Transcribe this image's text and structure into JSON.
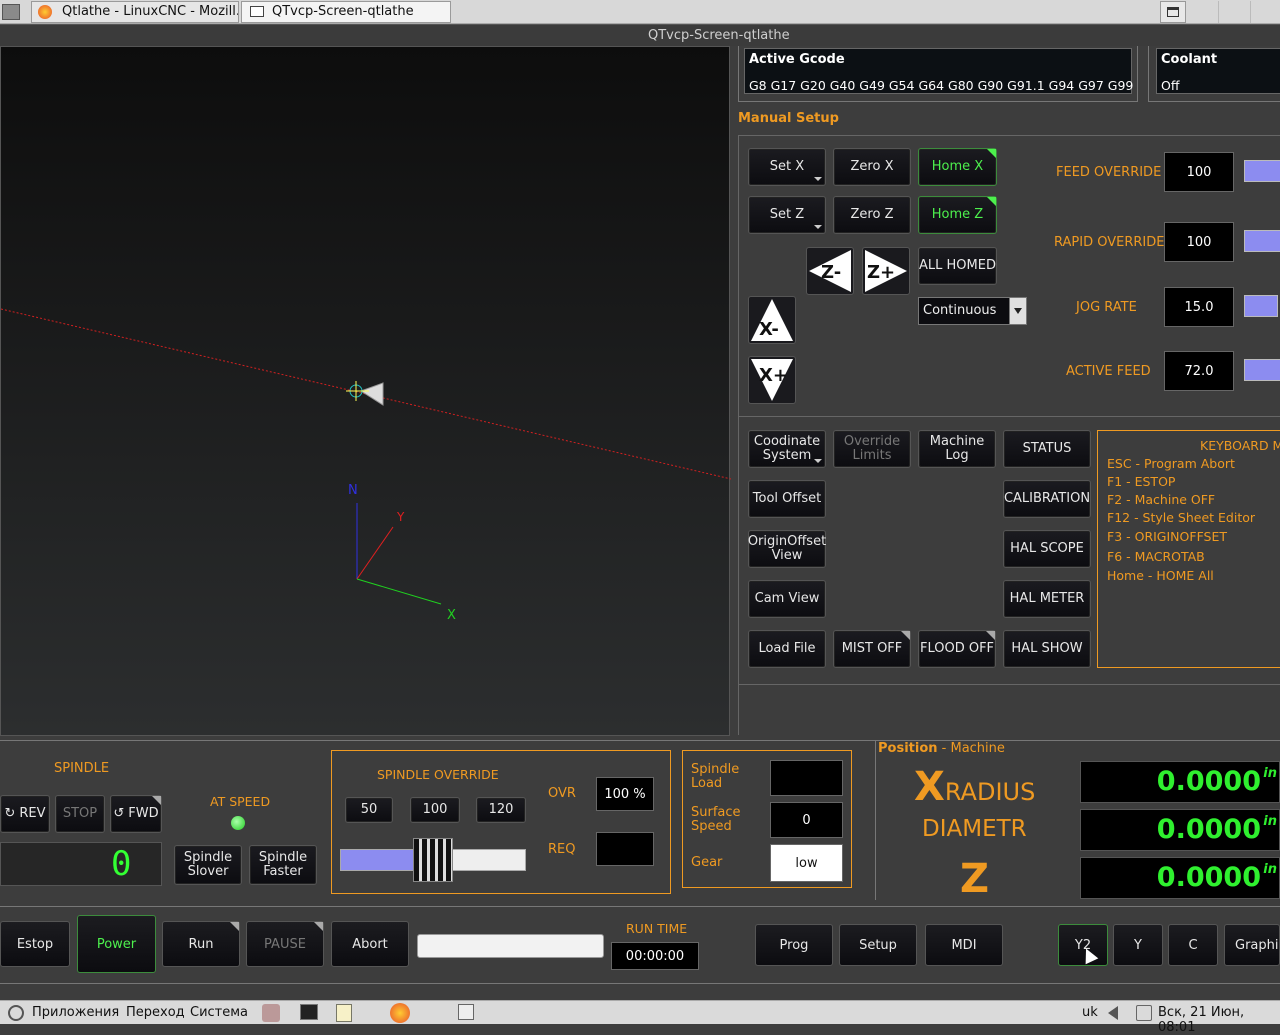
{
  "browser_tabs": [
    {
      "label": "Qtlathe - LinuxCNC - Mozill..."
    },
    {
      "label": "QTvcp-Screen-qtlathe"
    }
  ],
  "window_title": "QTvcp-Screen-qtlathe",
  "active_gcode": {
    "title": "Active Gcode",
    "codes": "G8 G17 G20 G40 G49 G54 G64 G80 G90 G91.1 G94 G97 G99"
  },
  "coolant": {
    "title": "Coolant",
    "value": "Off"
  },
  "manual_setup": {
    "title": "Manual Setup",
    "set_x": "Set X",
    "zero_x": "Zero X",
    "home_x": "Home X",
    "set_z": "Set Z",
    "zero_z": "Zero Z",
    "home_z": "Home Z",
    "all_homed": "ALL HOMED",
    "jog_mode": "Continuous",
    "jog_z_minus": "Z-",
    "jog_z_plus": "Z+",
    "jog_x_minus": "X-",
    "jog_x_plus": "X+",
    "feed_override_label": "FEED OVERRIDE",
    "feed_override": "100",
    "rapid_override_label": "RAPID OVERRIDE",
    "rapid_override": "100",
    "jog_rate_label": "JOG RATE",
    "jog_rate": "15.0",
    "active_feed_label": "ACTIVE FEED",
    "active_feed": "72.0"
  },
  "tools": {
    "coord_system": "Coodinate System",
    "override_limits": "Override Limits",
    "machine_log": "Machine Log",
    "status": "STATUS",
    "tool_offset": "Tool Offset",
    "calibration": "CALIBRATION",
    "origin_offset": "OriginOffset View",
    "hal_scope": "HAL SCOPE",
    "cam_view": "Cam View",
    "hal_meter": "HAL METER",
    "load_file": "Load File",
    "mist": "MIST OFF",
    "flood": "FLOOD OFF",
    "hal_show": "HAL SHOW"
  },
  "keyboard": {
    "title": "KEYBOARD M",
    "items": [
      "ESC - Program Abort",
      "F1 - ESTOP",
      "F2 - Machine OFF",
      "F12 - Style Sheet Editor",
      "F3 - ORIGINOFFSET",
      "F6 - MACROTAB",
      "Home - HOME All"
    ]
  },
  "spindle": {
    "title": "SPINDLE",
    "rev": "REV",
    "stop": "STOP",
    "fwd": "FWD",
    "at_speed": "AT SPEED",
    "slower": "Spindle Slover",
    "faster": "Spindle Faster",
    "display": "0"
  },
  "spindle_override": {
    "title": "SPINDLE OVERRIDE",
    "b50": "50",
    "b100": "100",
    "b120": "120",
    "ovr_label": "OVR",
    "ovr": "100 %",
    "req_label": "REQ",
    "req": "",
    "level": 0.5
  },
  "spindle_info": {
    "load_label": "Spindle Load",
    "load": "",
    "surface_label": "Surface Speed",
    "surface": "0",
    "gear_label": "Gear",
    "gear": "low"
  },
  "position": {
    "title": "Position",
    "mode": "- Machine",
    "x_big": "X",
    "x_rest": "RADIUS",
    "diam": "DIAMETR",
    "z": "Z",
    "x_val": "0.0000",
    "d_val": "0.0000",
    "z_val": "0.0000",
    "unit": "in"
  },
  "footer": {
    "estop": "Estop",
    "power": "Power",
    "run": "Run",
    "pause": "PAUSE",
    "abort": "Abort",
    "runtime_label": "RUN TIME",
    "runtime": "00:00:00",
    "prog": "Prog",
    "setup": "Setup",
    "mdi": "MDI",
    "y2": "Y2",
    "y": "Y",
    "c": "C",
    "graphics": "Graphic"
  },
  "taskbar": {
    "apps": "Приложения",
    "go": "Переход",
    "system": "Система",
    "lang": "uk",
    "clock": "Вск, 21 Июн, 08:01"
  },
  "colors": {
    "accent": "#ef9a22",
    "dro": "#2ff02f",
    "green": "#4df04d"
  }
}
